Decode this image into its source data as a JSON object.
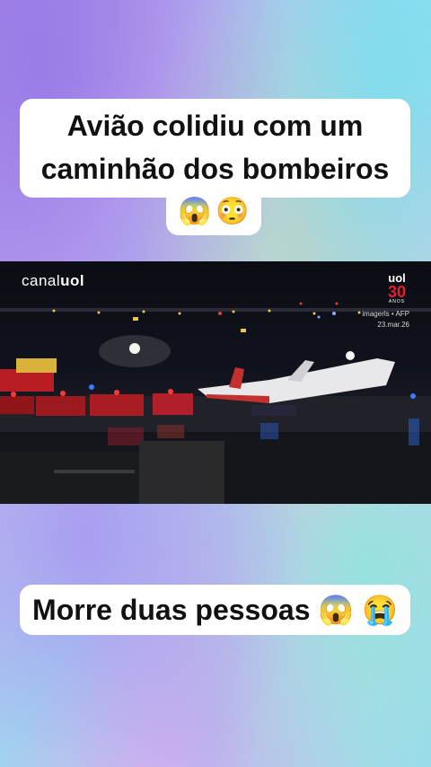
{
  "headline": {
    "line1": "Avião colidiu com um",
    "line2": "caminhão dos bombeiros",
    "emojis": [
      "😱",
      "😳"
    ]
  },
  "video": {
    "channel_prefix": "canal",
    "channel_brand": "uol",
    "corner_logo": {
      "brand": "uol",
      "number": "30",
      "caption": "ANOS"
    },
    "credit": "imagerls • AFP",
    "date": "23.mar.26"
  },
  "caption": {
    "text": "Morre duas pessoas",
    "emojis": [
      "😱",
      "😭"
    ]
  }
}
